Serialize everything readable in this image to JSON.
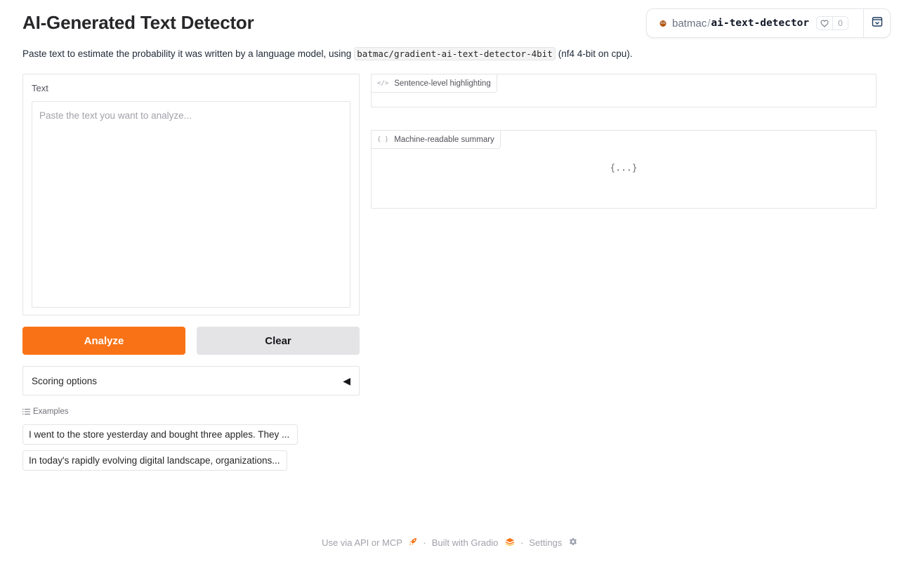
{
  "header": {
    "title": "AI-Generated Text Detector",
    "description_prefix": "Paste text to estimate the probability it was written by a language model, using",
    "model_id": "batmac/gradient-ai-text-detector-4bit",
    "description_suffix": "(nf4 4-bit on cpu)."
  },
  "space_badge": {
    "owner": "batmac",
    "separator": "/",
    "repo": "ai-text-detector",
    "likes": "0"
  },
  "input": {
    "label": "Text",
    "placeholder": "Paste the text you want to analyze..."
  },
  "buttons": {
    "analyze": "Analyze",
    "clear": "Clear"
  },
  "accordion": {
    "label": "Scoring options",
    "arrow": "◀"
  },
  "examples": {
    "label": "Examples",
    "items": [
      "I went to the store yesterday and bought three apples. They ...",
      "In today's rapidly evolving digital landscape, organizations..."
    ]
  },
  "outputs": {
    "highlight_label": "Sentence-level highlighting",
    "highlight_icon": "</>",
    "summary_label": "Machine-readable summary",
    "summary_icon": "{ }",
    "summary_empty": "{...}"
  },
  "footer": {
    "api": "Use via API or MCP",
    "built": "Built with Gradio",
    "settings": "Settings",
    "sep": "·"
  },
  "colors": {
    "primary": "#f97316",
    "secondary": "#e4e4e7"
  }
}
